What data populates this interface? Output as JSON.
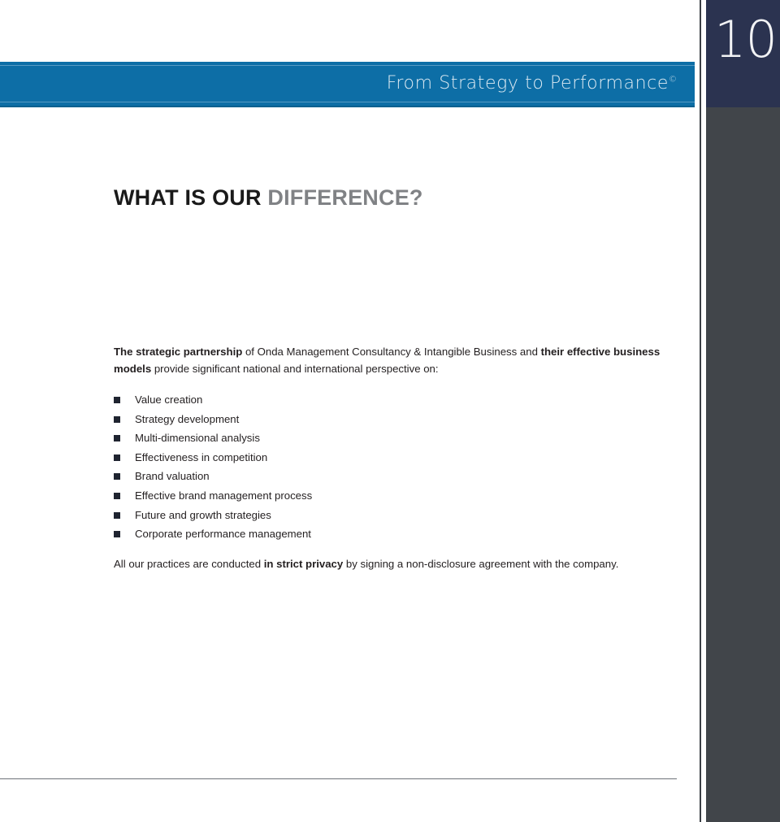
{
  "document": {
    "page_number": "10",
    "header": {
      "tagline": "From Strategy to Performance",
      "tagline_mark": "©"
    },
    "heading": {
      "part_dark": "WHAT IS OUR ",
      "part_gray": "DIFFERENCE?"
    },
    "intro": {
      "bold_1": "The strategic partnership",
      "text_1": " of Onda Management Consultancy & Intangible Business and ",
      "bold_2": "their effective business models",
      "text_2": " provide significant national and international perspective on:"
    },
    "bullets": [
      {
        "label": "Value creation"
      },
      {
        "label": "Strategy development"
      },
      {
        "label": "Multi-dimensional analysis"
      },
      {
        "label": "Effectiveness in competition"
      },
      {
        "label": "Brand valuation"
      },
      {
        "label": "Effective brand management process"
      },
      {
        "label": "Future and growth strategies"
      },
      {
        "label": "Corporate performance management"
      }
    ],
    "closing": {
      "text_1": "All our practices are conducted ",
      "bold_1": "in strict privacy",
      "text_2": " by signing a non-disclosure agreement with the company."
    },
    "colors": {
      "banner_blue": "#0d6ea6",
      "page_number_navy": "#2b3350",
      "side_panel_gray": "#41454a",
      "heading_gray": "#808285",
      "body_text": "#231f20"
    }
  }
}
